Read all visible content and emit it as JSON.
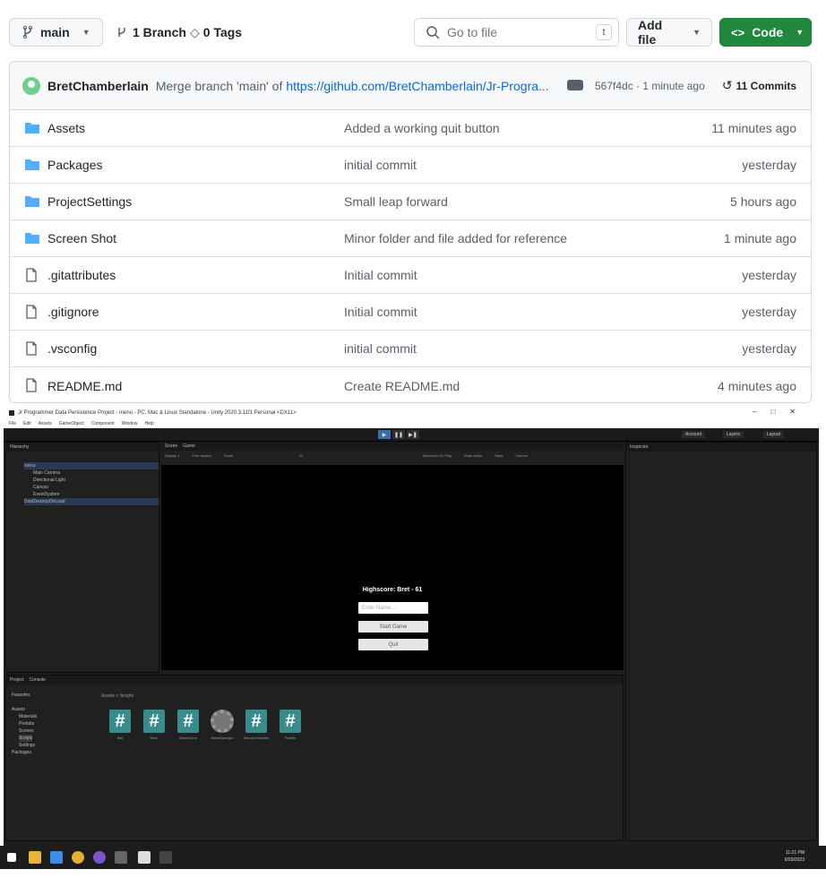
{
  "branch": {
    "name": "main",
    "branches": "1 Branch",
    "tags": "0 Tags"
  },
  "search": {
    "placeholder": "Go to file",
    "shortcut": "t"
  },
  "actions": {
    "add_file": "Add file",
    "code": "Code"
  },
  "commit": {
    "user": "BretChamberlain",
    "message": "Merge branch 'main' of",
    "link": "https://github.com/BretChamberlain/Jr-Progra...",
    "sha": "567f4dc · 1 minute ago",
    "commits": "11 Commits"
  },
  "files": [
    {
      "type": "folder",
      "name": "Assets",
      "message": "Added a working quit button",
      "age": "11 minutes ago"
    },
    {
      "type": "folder",
      "name": "Packages",
      "message": "initial commit",
      "age": "yesterday"
    },
    {
      "type": "folder",
      "name": "ProjectSettings",
      "message": "Small leap forward",
      "age": "5 hours ago"
    },
    {
      "type": "folder",
      "name": "Screen Shot",
      "message": "Minor folder and file added for reference",
      "age": "1 minute ago"
    },
    {
      "type": "file",
      "name": ".gitattributes",
      "message": "Initial commit",
      "age": "yesterday"
    },
    {
      "type": "file",
      "name": ".gitignore",
      "message": "Initial commit",
      "age": "yesterday"
    },
    {
      "type": "file",
      "name": ".vsconfig",
      "message": "initial commit",
      "age": "yesterday"
    },
    {
      "type": "file",
      "name": "README.md",
      "message": "Create README.md",
      "age": "4 minutes ago"
    }
  ],
  "unity": {
    "title": "Jr Programmer Data Persistence Project - menu - PC, Mac & Linux Standalone - Unity 2020.3.11f1 Personal <DX11>",
    "menu": [
      "File",
      "Edit",
      "Assets",
      "GameObject",
      "Component",
      "Window",
      "Help"
    ],
    "toolbar": {
      "account": "Account",
      "layers": "Layers",
      "layout": "Layout"
    },
    "hierarchy_tab": "Hierarchy",
    "hierarchy": [
      "menu",
      "Main Camera",
      "Directional Light",
      "Canvas",
      "EventSystem",
      "DontDestroyOnLoad"
    ],
    "scene_tabs": [
      "Scene",
      "Game"
    ],
    "game_header": {
      "display": "Display 1",
      "aspect": "Free Aspect",
      "scale": "Scale",
      "scale_value": "1x",
      "maximize": "Maximize On Play",
      "mute": "Mute Audio",
      "stats": "Stats",
      "gizmos": "Gizmos"
    },
    "inspector_tab": "Inspector",
    "game": {
      "highscore": "Highscore: Bret - 61",
      "name_placeholder": "Enter Name...",
      "start": "Start Game",
      "quit": "Quit"
    },
    "project_tabs": [
      "Project",
      "Console"
    ],
    "project_tree": [
      "Favorites",
      "Assets",
      "Materials",
      "Prefabs",
      "Scenes",
      "Scripts",
      "Settings",
      "Packages"
    ],
    "breadcrumb": "Assets > Scripts",
    "assets": [
      "Ball",
      "Brick",
      "DeathZone",
      "MainManager",
      "MenuUIHandler",
      "Paddle"
    ]
  },
  "taskbar": {
    "time": "11:21 PM",
    "date": "6/29/2023"
  }
}
